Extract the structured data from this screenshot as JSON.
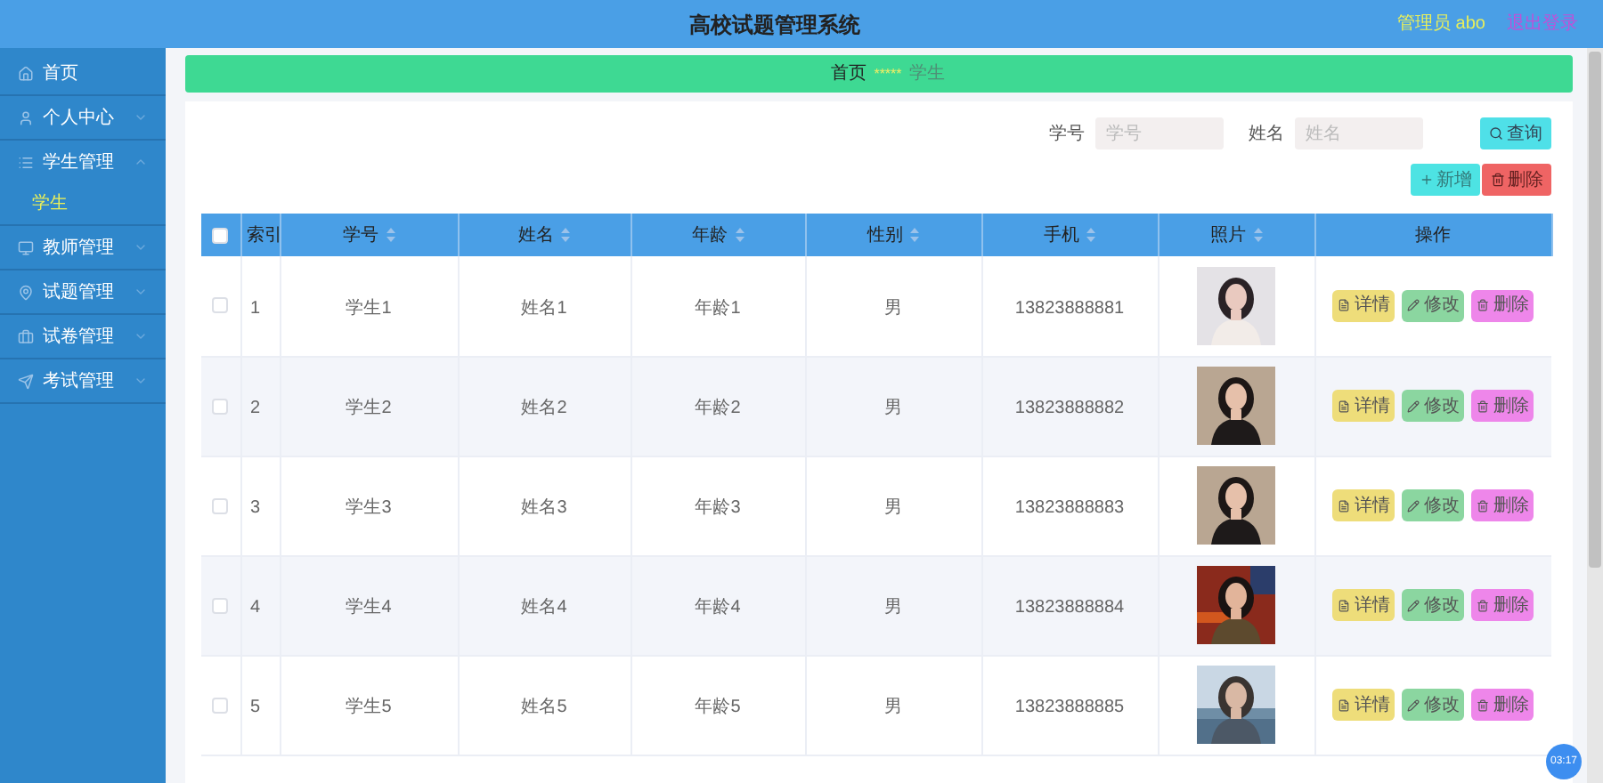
{
  "header": {
    "title": "高校试题管理系统",
    "user": "管理员 abo",
    "logout": "退出登录"
  },
  "sidebar": {
    "items": [
      {
        "kind": "link",
        "label": "首页"
      },
      {
        "kind": "group",
        "label": "个人中心",
        "expanded": false
      },
      {
        "kind": "group",
        "label": "学生管理",
        "expanded": true,
        "children": [
          {
            "label": "学生",
            "selected": true
          }
        ]
      },
      {
        "kind": "group",
        "label": "教师管理",
        "expanded": false
      },
      {
        "kind": "group",
        "label": "试题管理",
        "expanded": false
      },
      {
        "kind": "group",
        "label": "试卷管理",
        "expanded": false
      },
      {
        "kind": "group",
        "label": "考试管理",
        "expanded": false
      }
    ]
  },
  "breadcrumb": {
    "home": "首页",
    "separator": "*****",
    "current": "学生"
  },
  "search": {
    "fields": [
      {
        "label": "学号",
        "placeholder": "学号"
      },
      {
        "label": "姓名",
        "placeholder": "姓名"
      }
    ],
    "button": "查询"
  },
  "toolbar": {
    "add": "新增",
    "delete": "删除"
  },
  "table": {
    "select_all": {
      "checked": false
    },
    "columns": [
      {
        "label": "索引",
        "sortable": false
      },
      {
        "label": "学号",
        "sortable": true
      },
      {
        "label": "姓名",
        "sortable": true
      },
      {
        "label": "年龄",
        "sortable": true
      },
      {
        "label": "性别",
        "sortable": true
      },
      {
        "label": "手机",
        "sortable": true
      },
      {
        "label": "照片",
        "sortable": true
      },
      {
        "label": "操作",
        "sortable": false
      }
    ],
    "rows": [
      {
        "checked": false,
        "cells": [
          "1",
          "学生1",
          "姓名1",
          "年龄1",
          "男",
          "13823888881"
        ],
        "photo": {
          "kind": "picture"
        },
        "actions": [
          "详情",
          "修改",
          "删除"
        ]
      },
      {
        "checked": false,
        "cells": [
          "2",
          "学生2",
          "姓名2",
          "年龄2",
          "男",
          "13823888882"
        ],
        "photo": {
          "kind": "picture"
        },
        "actions": [
          "详情",
          "修改",
          "删除"
        ]
      },
      {
        "checked": false,
        "cells": [
          "3",
          "学生3",
          "姓名3",
          "年龄3",
          "男",
          "13823888883"
        ],
        "photo": {
          "kind": "picture"
        },
        "actions": [
          "详情",
          "修改",
          "删除"
        ]
      },
      {
        "checked": false,
        "cells": [
          "4",
          "学生4",
          "姓名4",
          "年龄4",
          "男",
          "13823888884"
        ],
        "photo": {
          "kind": "picture"
        },
        "actions": [
          "详情",
          "修改",
          "删除"
        ]
      },
      {
        "checked": false,
        "cells": [
          "5",
          "学生5",
          "姓名5",
          "年龄5",
          "男",
          "13823888885"
        ],
        "photo": {
          "kind": "picture"
        },
        "actions": [
          "详情",
          "修改",
          "删除"
        ]
      }
    ]
  },
  "timer": "03:17"
}
